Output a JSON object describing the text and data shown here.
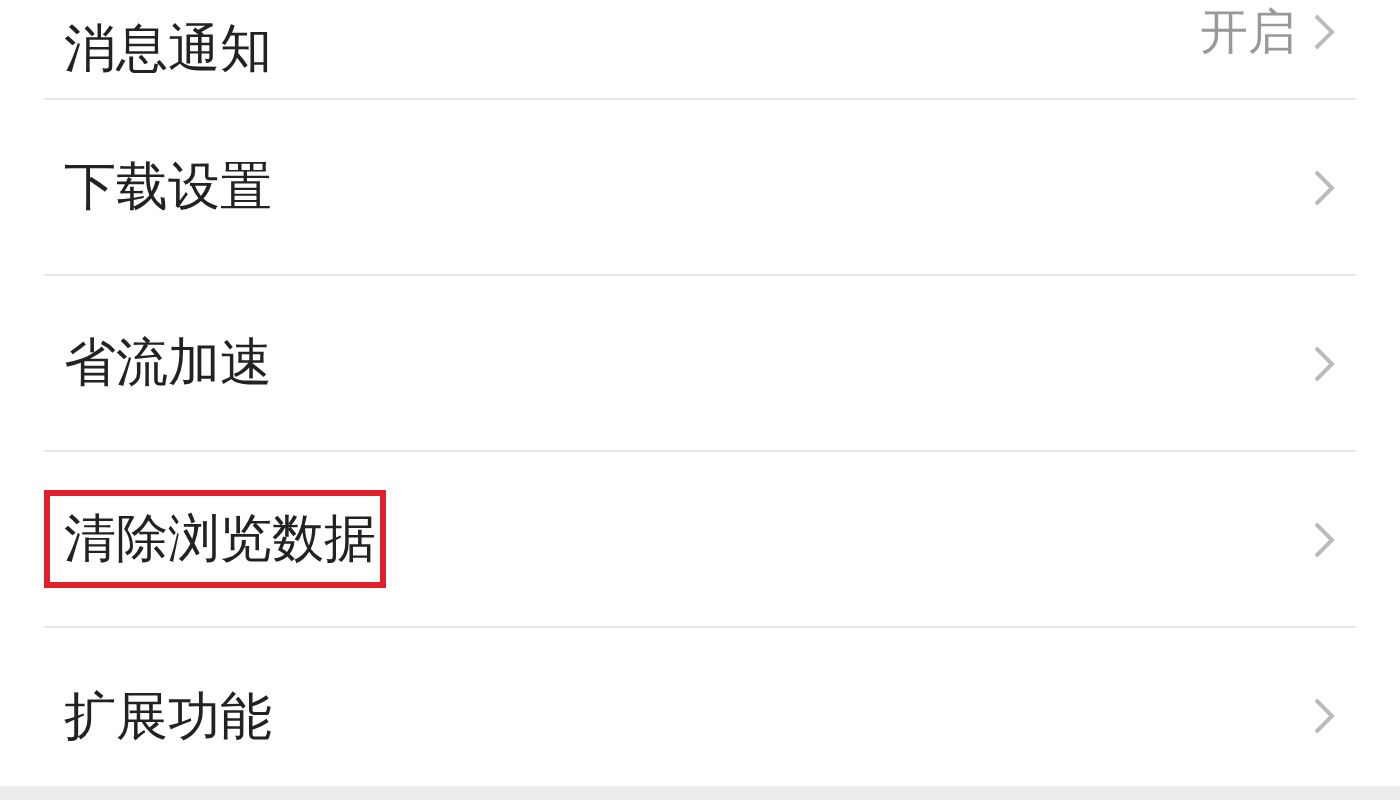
{
  "settings": [
    {
      "label": "消息通知",
      "value": "开启",
      "highlighted": false
    },
    {
      "label": "下载设置",
      "highlighted": false
    },
    {
      "label": "省流加速",
      "highlighted": false
    },
    {
      "label": "清除浏览数据",
      "highlighted": true
    },
    {
      "label": "扩展功能",
      "highlighted": false
    }
  ]
}
